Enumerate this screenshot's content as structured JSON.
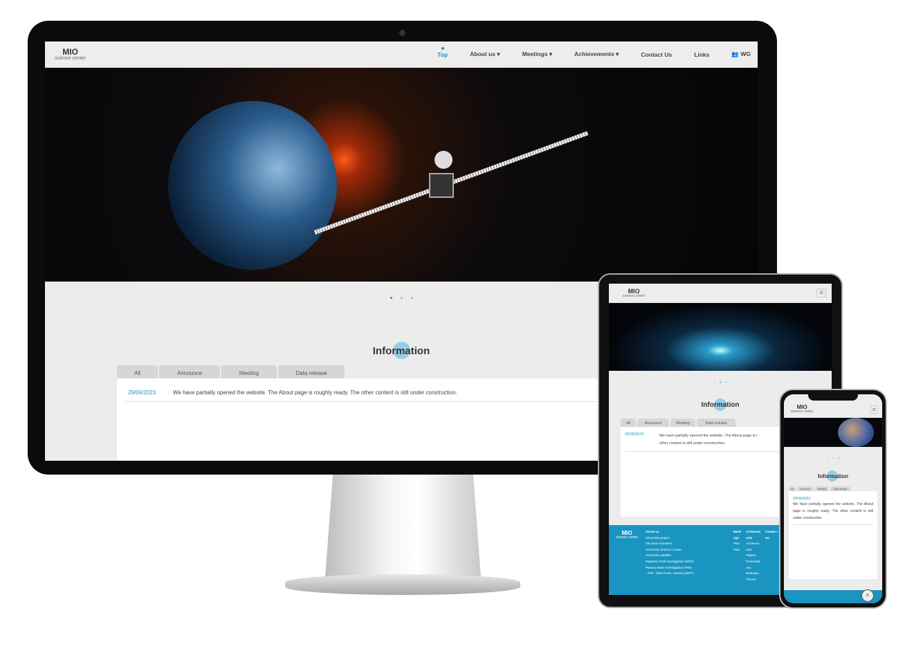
{
  "site": {
    "logo_title": "MIO",
    "logo_subtitle": "science center"
  },
  "nav": {
    "items": [
      {
        "label": "Top",
        "active": true
      },
      {
        "label": "About us ▾"
      },
      {
        "label": "Meetings ▾"
      },
      {
        "label": "Achievements ▾"
      },
      {
        "label": "Contact Us"
      },
      {
        "label": "Links"
      },
      {
        "label": "WG",
        "icon": "users-icon"
      }
    ]
  },
  "info": {
    "title": "Information",
    "tabs": [
      "All",
      "Announce",
      "Meeting",
      "Data release"
    ],
    "entries": [
      {
        "date": "29/06/2023",
        "text": "We have partially opened the website. The About page is roughly ready. The other content is still under construction."
      }
    ]
  },
  "tablet": {
    "text_line1": "We have partially opened the website. The About page is r",
    "text_line2": "other content is still under construction."
  },
  "footer": {
    "about_heading": "About us",
    "about_links": [
      "About Mio project",
      "Mio team members",
      "About Mio Science Center",
      "About Mio satellite",
      "Magnetic Field Investigation (MGF)",
      "Plasma Wave Investigation (PWI)",
      "- PWI - Wire Probe Antenna (WPT)"
    ],
    "meetings_heading": "Meeti ngs",
    "meetings_links": [
      "Plan",
      "Past"
    ],
    "achievements_heading": "Achievem ents",
    "achievements_links": [
      "Achievem ents",
      "Papers",
      "Presentati ons",
      "Releases",
      "Theses"
    ],
    "contact_heading": "Contac t Us"
  },
  "colors": {
    "accent": "#1a94c0",
    "footer": "#1a94c0"
  }
}
